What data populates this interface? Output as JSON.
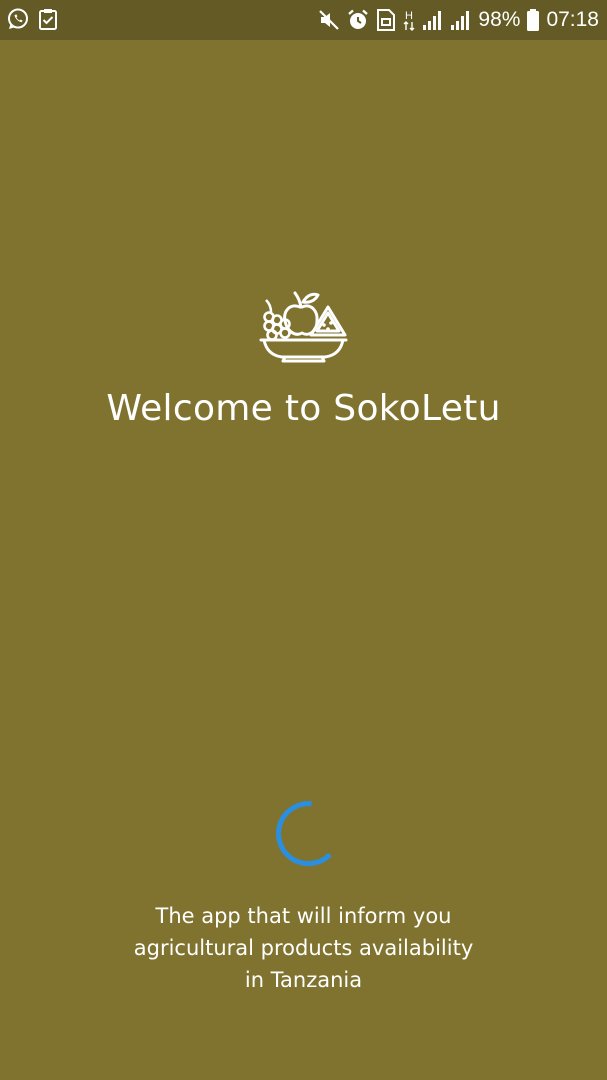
{
  "theme": {
    "background": "#80732f",
    "status_bar_background": "#635a25",
    "spinner_color": "#2a8fe0",
    "text_color": "#ffffff"
  },
  "status_bar": {
    "left_icons": [
      "whatsapp-icon",
      "clipboard-check-icon"
    ],
    "right_icons": [
      "mute-icon",
      "alarm-icon",
      "sim-icon",
      "data-h-icon",
      "signal-1-icon",
      "signal-2-icon",
      "battery-icon"
    ],
    "network_type": "H",
    "battery_percent": "98%",
    "time": "07:18"
  },
  "splash": {
    "logo_icon": "fruit-bowl-icon",
    "title": "Welcome to SokoLetu",
    "loading_indicator": "loading-spinner",
    "tagline_lines": [
      "The app that will inform you",
      "agricultural products availability",
      "in Tanzania"
    ]
  }
}
